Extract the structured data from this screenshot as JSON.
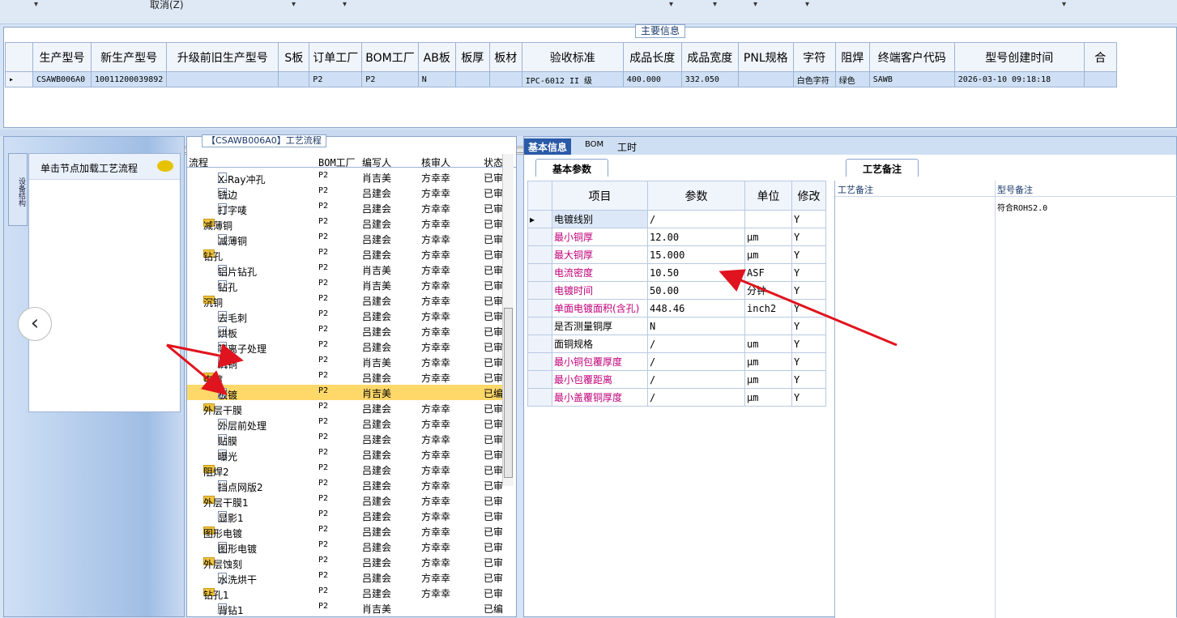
{
  "toolbar": {
    "cancel_label": "取消(Z)",
    "dropdown_glyph": "▾"
  },
  "main_info": {
    "title": "主要信息",
    "columns": [
      "生产型号",
      "新生产型号",
      "升级前旧生产型号",
      "S板",
      "订单工厂",
      "BOM工厂",
      "AB板",
      "板厚",
      "板材",
      "验收标准",
      "成品长度",
      "成品宽度",
      "PNL规格",
      "字符",
      "阻焊",
      "终端客户代码",
      "型号创建时间",
      "合"
    ],
    "row": [
      "CSAWB006A0",
      "10011200039892",
      "",
      "",
      "P2",
      "P2",
      "N",
      "",
      "",
      "IPC-6012 II 级",
      "400.000",
      "332.050",
      "",
      "白色字符",
      "绿色",
      "SAWB",
      "2026-03-10 09:18:18",
      ""
    ]
  },
  "left_panel": {
    "vertical_tab": "设备结构",
    "node_hint": "单击节点加载工艺流程",
    "prev_glyph": "‹",
    "next_glyph": "›"
  },
  "flow": {
    "title": "【CSAWB006A0】工艺流程",
    "headers": [
      "流程",
      "BOM工厂",
      "编写人",
      "核审人",
      "状态"
    ],
    "rows": [
      {
        "name": "X-Ray冲孔",
        "folder": false,
        "bom": "P2",
        "writer": "肖吉美",
        "checker": "方幸幸",
        "status": "已审"
      },
      {
        "name": "铣边",
        "folder": false,
        "bom": "P2",
        "writer": "吕建会",
        "checker": "方幸幸",
        "status": "已审"
      },
      {
        "name": "打字唛",
        "folder": false,
        "bom": "P2",
        "writer": "吕建会",
        "checker": "方幸幸",
        "status": "已审"
      },
      {
        "name": "减薄铜",
        "folder": true,
        "bom": "P2",
        "writer": "吕建会",
        "checker": "方幸幸",
        "status": "已审"
      },
      {
        "name": "减薄铜",
        "folder": false,
        "bom": "P2",
        "writer": "吕建会",
        "checker": "方幸幸",
        "status": "已审"
      },
      {
        "name": "钻孔",
        "folder": true,
        "bom": "P2",
        "writer": "吕建会",
        "checker": "方幸幸",
        "status": "已审"
      },
      {
        "name": "铝片钻孔",
        "folder": false,
        "bom": "P2",
        "writer": "肖吉美",
        "checker": "方幸幸",
        "status": "已审"
      },
      {
        "name": "钻孔",
        "folder": false,
        "bom": "P2",
        "writer": "肖吉美",
        "checker": "方幸幸",
        "status": "已审"
      },
      {
        "name": "沉铜",
        "folder": true,
        "bom": "P2",
        "writer": "吕建会",
        "checker": "方幸幸",
        "status": "已审"
      },
      {
        "name": "去毛刺",
        "folder": false,
        "bom": "P2",
        "writer": "吕建会",
        "checker": "方幸幸",
        "status": "已审"
      },
      {
        "name": "烘板",
        "folder": false,
        "bom": "P2",
        "writer": "吕建会",
        "checker": "方幸幸",
        "status": "已审"
      },
      {
        "name": "等离子处理",
        "folder": false,
        "bom": "P2",
        "writer": "吕建会",
        "checker": "方幸幸",
        "status": "已审"
      },
      {
        "name": "沉铜",
        "folder": false,
        "bom": "P2",
        "writer": "肖吉美",
        "checker": "方幸幸",
        "status": "已审"
      },
      {
        "name": "电镀",
        "folder": true,
        "bom": "P2",
        "writer": "吕建会",
        "checker": "方幸幸",
        "status": "已审"
      },
      {
        "name": "板镀",
        "folder": false,
        "bom": "P2",
        "writer": "肖吉美",
        "checker": "",
        "status": "已编",
        "selected": true
      },
      {
        "name": "外层干膜",
        "folder": true,
        "bom": "P2",
        "writer": "吕建会",
        "checker": "方幸幸",
        "status": "已审"
      },
      {
        "name": "外层前处理",
        "folder": false,
        "bom": "P2",
        "writer": "吕建会",
        "checker": "方幸幸",
        "status": "已审"
      },
      {
        "name": "贴膜",
        "folder": false,
        "bom": "P2",
        "writer": "吕建会",
        "checker": "方幸幸",
        "status": "已审"
      },
      {
        "name": "曝光",
        "folder": false,
        "bom": "P2",
        "writer": "吕建会",
        "checker": "方幸幸",
        "status": "已审"
      },
      {
        "name": "阻焊2",
        "folder": true,
        "bom": "P2",
        "writer": "吕建会",
        "checker": "方幸幸",
        "status": "已审"
      },
      {
        "name": "挡点网版2",
        "folder": false,
        "bom": "P2",
        "writer": "吕建会",
        "checker": "方幸幸",
        "status": "已审"
      },
      {
        "name": "外层干膜1",
        "folder": true,
        "bom": "P2",
        "writer": "吕建会",
        "checker": "方幸幸",
        "status": "已审"
      },
      {
        "name": "显影1",
        "folder": false,
        "bom": "P2",
        "writer": "吕建会",
        "checker": "方幸幸",
        "status": "已审"
      },
      {
        "name": "图形电镀",
        "folder": true,
        "bom": "P2",
        "writer": "吕建会",
        "checker": "方幸幸",
        "status": "已审"
      },
      {
        "name": "图形电镀",
        "folder": false,
        "bom": "P2",
        "writer": "吕建会",
        "checker": "方幸幸",
        "status": "已审"
      },
      {
        "name": "外层蚀刻",
        "folder": true,
        "bom": "P2",
        "writer": "吕建会",
        "checker": "方幸幸",
        "status": "已审"
      },
      {
        "name": "水洗烘干",
        "folder": false,
        "bom": "P2",
        "writer": "吕建会",
        "checker": "方幸幸",
        "status": "已审"
      },
      {
        "name": "钻孔1",
        "folder": true,
        "bom": "P2",
        "writer": "吕建会",
        "checker": "方幸幸",
        "status": "已审"
      },
      {
        "name": "背钻1",
        "folder": false,
        "bom": "P2",
        "writer": "肖吉美",
        "checker": "",
        "status": "已编"
      }
    ]
  },
  "right": {
    "tabs": [
      "基本信息",
      "BOM",
      "工时"
    ],
    "basic_tab": "基本参数",
    "param_headers": [
      "项目",
      "参数",
      "单位",
      "修改"
    ],
    "params": [
      {
        "item": "电镀线别",
        "value": "/",
        "unit": "",
        "mod": "Y",
        "pink": false
      },
      {
        "item": "最小铜厚",
        "value": "12.00",
        "unit": "μm",
        "mod": "Y",
        "pink": true
      },
      {
        "item": "最大铜厚",
        "value": "15.000",
        "unit": "μm",
        "mod": "Y",
        "pink": true
      },
      {
        "item": "电流密度",
        "value": "10.50",
        "unit": "ASF",
        "mod": "Y",
        "pink": true
      },
      {
        "item": "电镀时间",
        "value": "50.00",
        "unit": "分钟",
        "mod": "Y",
        "pink": true
      },
      {
        "item": "单面电镀面积(含孔)",
        "value": "448.46",
        "unit": "inch2",
        "mod": "Y",
        "pink": true
      },
      {
        "item": "是否测量铜厚",
        "value": "N",
        "unit": "",
        "mod": "Y",
        "pink": false
      },
      {
        "item": "面铜规格",
        "value": "/",
        "unit": "um",
        "mod": "Y",
        "pink": false
      },
      {
        "item": "最小铜包覆厚度",
        "value": "/",
        "unit": "μm",
        "mod": "Y",
        "pink": true
      },
      {
        "item": "最小包覆距离",
        "value": "/",
        "unit": "μm",
        "mod": "Y",
        "pink": true
      },
      {
        "item": "最小盖覆铜厚度",
        "value": "/",
        "unit": "μm",
        "mod": "Y",
        "pink": true
      }
    ],
    "notes_tab": "工艺备注",
    "notes_col1": "工艺备注",
    "notes_col2": "型号备注",
    "model_note": "符合ROHS2.0"
  },
  "colors": {
    "accent": "#2a5aa8",
    "arrow": "#e0141e",
    "selected_row": "#ffd86a",
    "pink_text": "#c0007a"
  }
}
